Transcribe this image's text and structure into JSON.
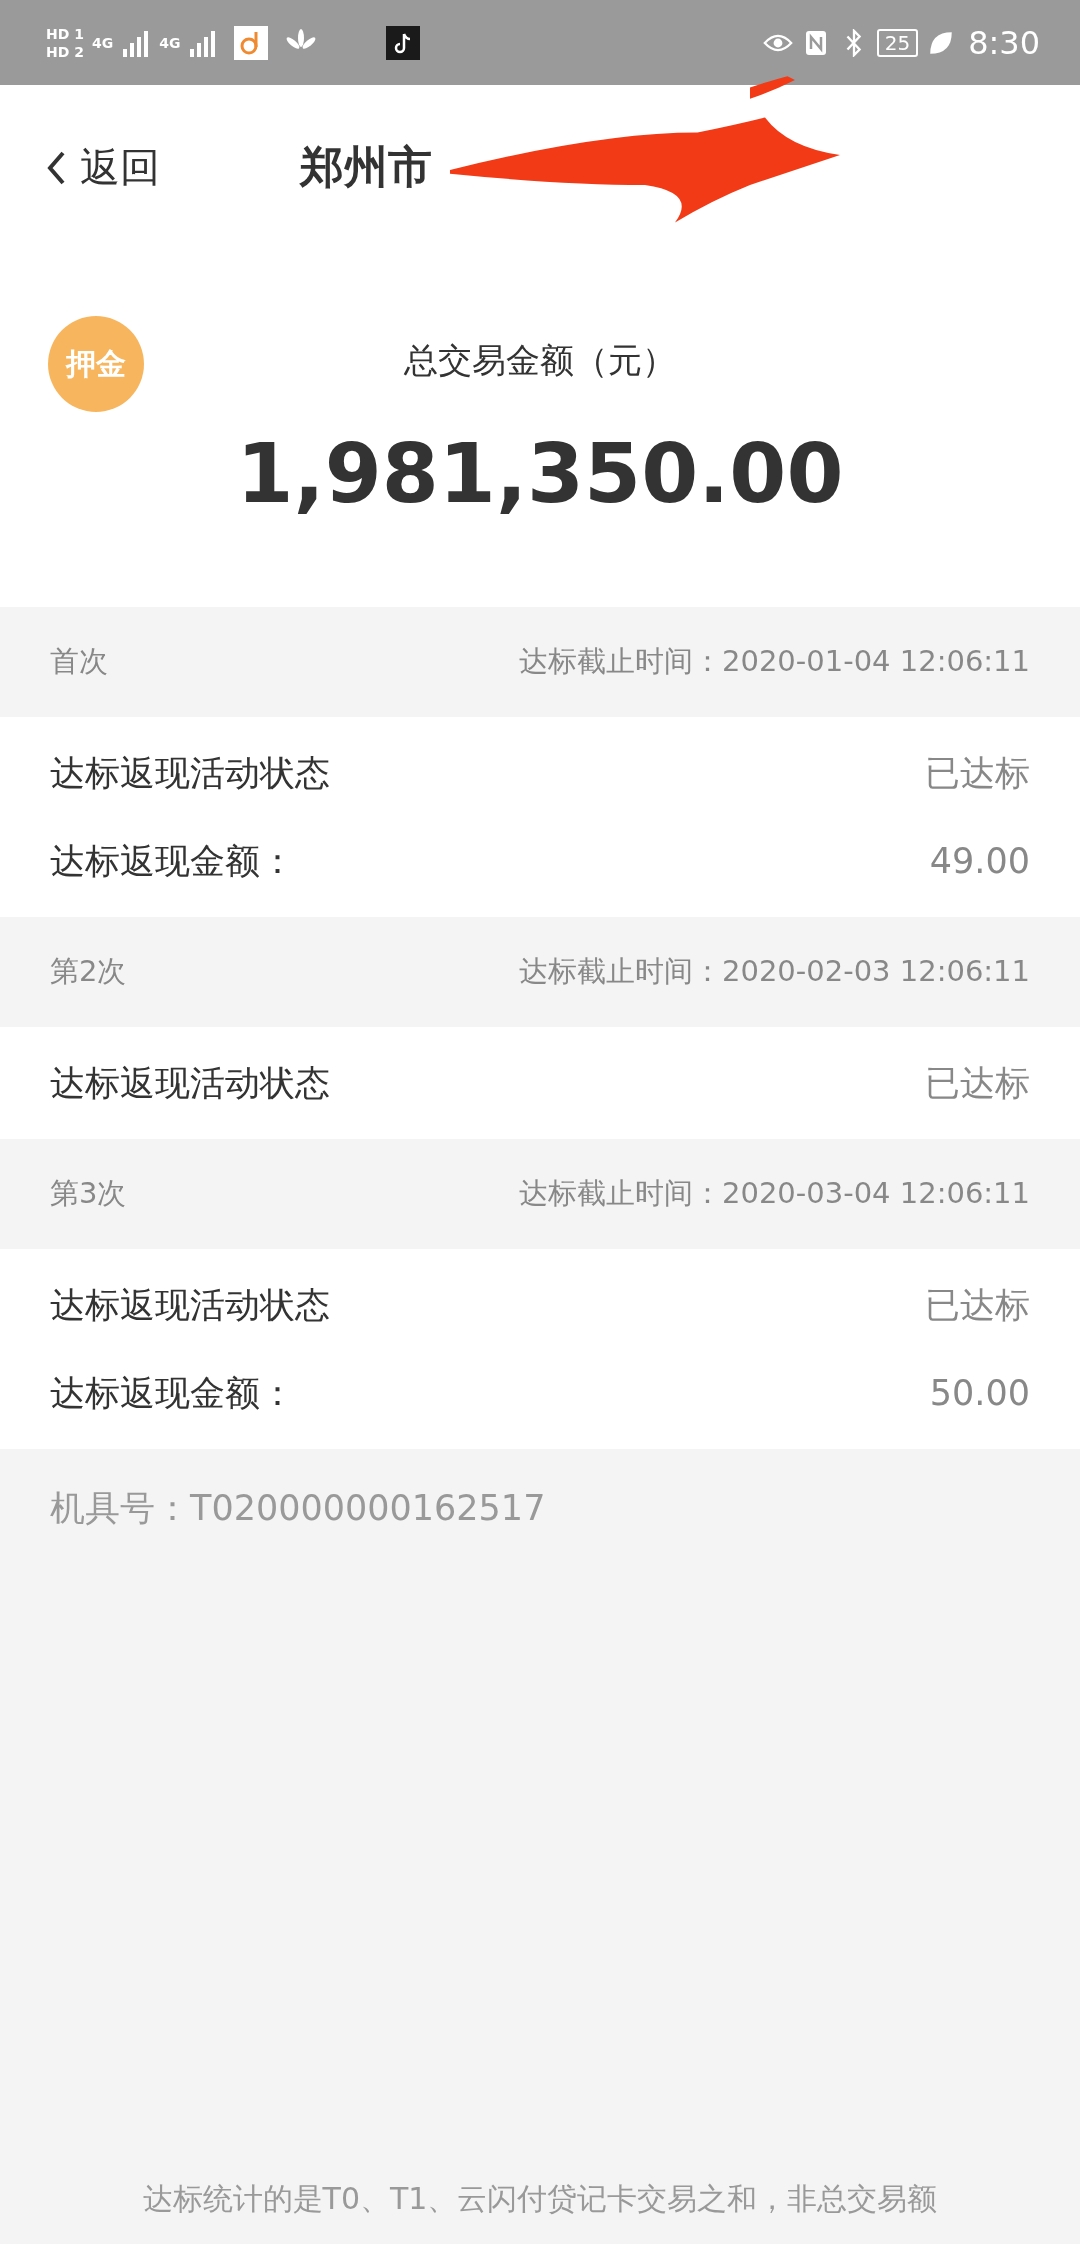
{
  "status_bar": {
    "sim_labels": [
      "HD 1",
      "HD 2"
    ],
    "network_labels": [
      "4G",
      "4G"
    ],
    "battery": "25",
    "time": "8:30"
  },
  "header": {
    "back": "返回",
    "title": "郑州市"
  },
  "summary": {
    "badge": "押金",
    "label": "总交易金额（元）",
    "amount": "1,981,350.00"
  },
  "sections": [
    {
      "name": "首次",
      "deadline": "达标截止时间：2020-01-04 12:06:11",
      "rows": [
        {
          "label": "达标返现活动状态",
          "value": "已达标"
        },
        {
          "label": "达标返现金额：",
          "value": "49.00"
        }
      ]
    },
    {
      "name": "第2次",
      "deadline": "达标截止时间：2020-02-03 12:06:11",
      "rows": [
        {
          "label": "达标返现活动状态",
          "value": "已达标"
        }
      ]
    },
    {
      "name": "第3次",
      "deadline": "达标截止时间：2020-03-04 12:06:11",
      "rows": [
        {
          "label": "达标返现活动状态",
          "value": "已达标"
        },
        {
          "label": "达标返现金额：",
          "value": "50.00"
        }
      ]
    }
  ],
  "device_number": "机具号：T020000000162517",
  "footnote": "达标统计的是T0、T1、云闪付贷记卡交易之和，非总交易额"
}
